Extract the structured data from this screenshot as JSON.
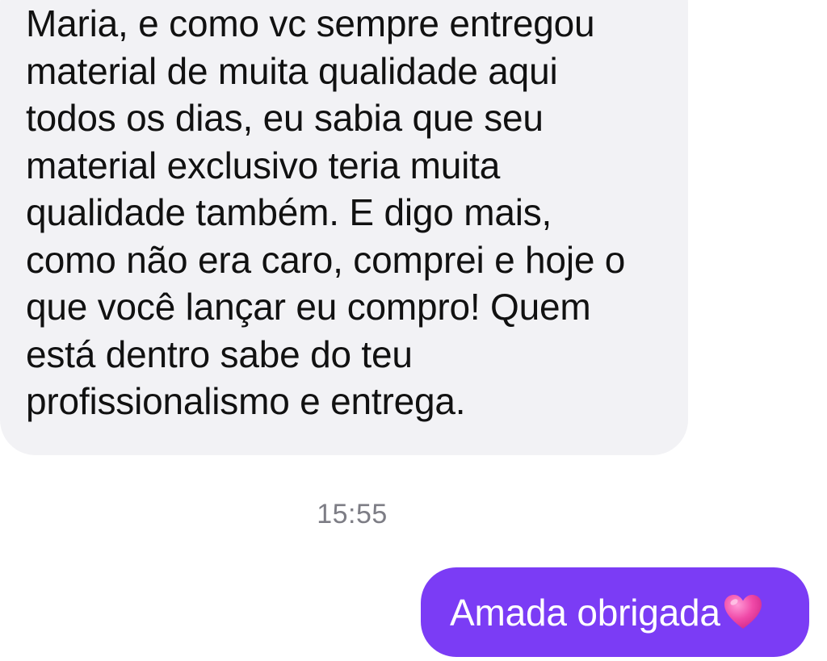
{
  "conversation": {
    "received_message": {
      "text": "Maria, e como vc sempre entregou\nmaterial de muita qualidade aqui\ntodos os dias, eu sabia que seu\nmaterial exclusivo teria muita\nqualidade também. E digo mais,\ncomo não era caro, comprei e hoje o\nque você lançar eu compro! Quem\nestá dentro sabe do teu\nprofissionalismo e entrega."
    },
    "timestamp": "15:55",
    "sent_message": {
      "text": "Amada obrigada",
      "emoji_icon": "pink-heart-icon"
    }
  },
  "colors": {
    "received_bubble": "#f2f2f5",
    "sent_bubble": "#7b3cf5",
    "timestamp": "#7d7d85",
    "heart": "#f04aa8"
  }
}
